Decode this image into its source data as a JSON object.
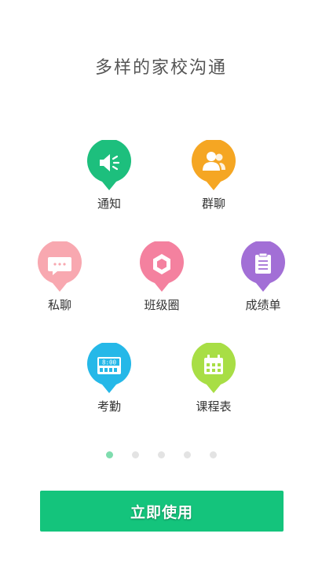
{
  "title": "多样的家校沟通",
  "features": [
    {
      "label": "通知",
      "icon": "speaker-icon",
      "color": "#1dbf7d"
    },
    {
      "label": "群聊",
      "icon": "group-users-icon",
      "color": "#f5a623"
    },
    {
      "label": "私聊",
      "icon": "chat-bubble-icon",
      "color": "#f8a8b0"
    },
    {
      "label": "班级圈",
      "icon": "hexagon-icon",
      "color": "#f4819f"
    },
    {
      "label": "成绩单",
      "icon": "report-card-icon",
      "color": "#a26fd6"
    },
    {
      "label": "考勤",
      "icon": "attendance-clock-icon",
      "color": "#25b8e8"
    },
    {
      "label": "课程表",
      "icon": "calendar-icon",
      "color": "#a8de45"
    }
  ],
  "attendance_display": "8:00",
  "pagination": {
    "total": 5,
    "active_index": 0,
    "active_color": "#7fdcae"
  },
  "cta_label": "立即使用",
  "cta_color": "#14c47c"
}
